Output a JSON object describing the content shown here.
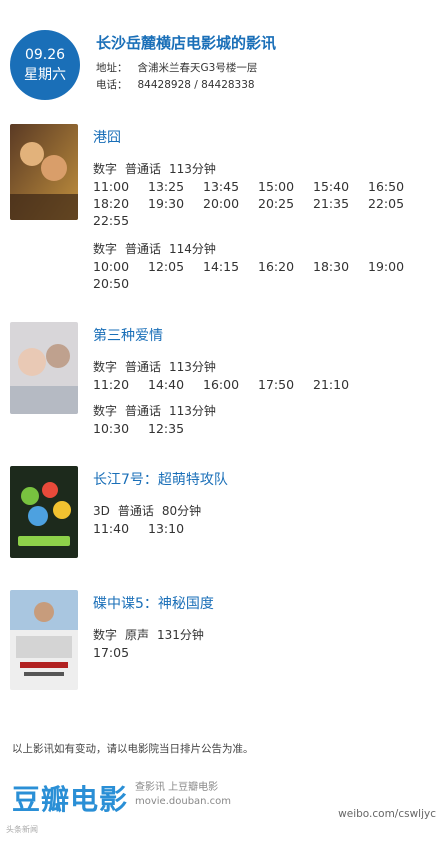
{
  "header": {
    "date": "09.26",
    "weekday": "星期六",
    "title": "长沙岳麓横店电影城的影讯",
    "address_label": "地址：",
    "address": "含浦米兰春天G3号楼一层",
    "phone_label": "电话：",
    "phone": "84428928 / 84428338"
  },
  "films": [
    {
      "title": "港囧",
      "blocks": [
        {
          "format": "数字",
          "language": "普通话",
          "duration": "113分钟",
          "times": [
            "11:00",
            "13:25",
            "13:45",
            "15:00",
            "15:40",
            "16:50",
            "18:20",
            "19:30",
            "20:00",
            "20:25",
            "21:35",
            "22:05",
            "22:55"
          ]
        },
        {
          "format": "数字",
          "language": "普通话",
          "duration": "114分钟",
          "times": [
            "10:00",
            "12:05",
            "14:15",
            "16:20",
            "18:30",
            "19:00",
            "20:50"
          ]
        }
      ]
    },
    {
      "title": "第三种爱情",
      "blocks": [
        {
          "format": "数字",
          "language": "普通话",
          "duration": "113分钟",
          "times": [
            "11:20",
            "14:40",
            "16:00",
            "17:50",
            "21:10"
          ]
        },
        {
          "format": "数字",
          "language": "普通话",
          "duration": "113分钟",
          "times": [
            "10:30",
            "12:35"
          ]
        }
      ]
    },
    {
      "title": "长江7号：超萌特攻队",
      "blocks": [
        {
          "format": "3D",
          "language": "普通话",
          "duration": "80分钟",
          "times": [
            "11:40",
            "13:10"
          ]
        }
      ]
    },
    {
      "title": "碟中谍5：神秘国度",
      "blocks": [
        {
          "format": "数字",
          "language": "原声",
          "duration": "131分钟",
          "times": [
            "17:05"
          ]
        }
      ]
    }
  ],
  "footer": {
    "notice": "以上影讯如有变动，请以电影院当日排片公告为准。",
    "logo": "豆瓣电影",
    "sub1": "查影讯 上豆瓣电影",
    "sub2": "movie.douban.com",
    "watermark": "weibo.com/cswljyc",
    "watermark2": "头条新闻"
  },
  "colors": {
    "accent": "#1a6fb8",
    "douban": "#2a8fd6"
  }
}
